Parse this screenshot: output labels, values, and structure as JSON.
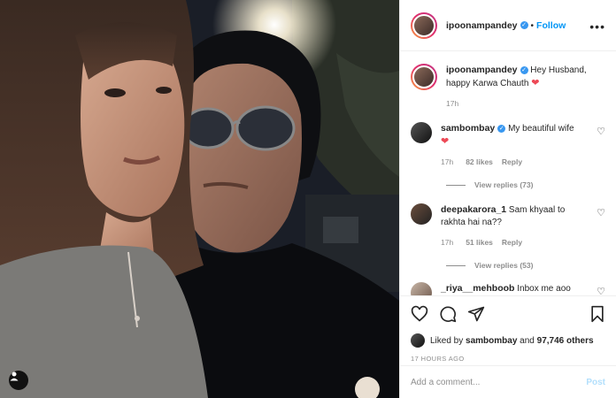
{
  "post": {
    "author": "ipoonampandey",
    "follow_label": "Follow",
    "more_label": "•••",
    "caption": {
      "user": "ipoonampandey",
      "text": "Hey Husband, happy Karwa Chauth",
      "time": "17h"
    }
  },
  "comments": [
    {
      "user": "sambombay",
      "verified": true,
      "text": "My beautiful wife",
      "time": "17h",
      "likes": "82 likes",
      "reply": "Reply",
      "view_replies": "View replies (73)"
    },
    {
      "user": "deepakarora_1",
      "verified": false,
      "text": "Sam khyaal to rakhta hai na??",
      "time": "17h",
      "likes": "51 likes",
      "reply": "Reply",
      "view_replies": "View replies (53)"
    },
    {
      "user": "_riya__mehboob",
      "verified": false,
      "text": "Inbox me aoo"
    }
  ],
  "liked_by": {
    "prefix": "Liked by",
    "user": "sambombay",
    "joiner": "and",
    "count": "97,746 others"
  },
  "timestamp": "17 HOURS AGO",
  "add_comment": {
    "placeholder": "Add a comment...",
    "post_label": "Post"
  },
  "colors": {
    "accent": "#0095f6",
    "heart": "#ed4956",
    "verified": "#3897f0"
  },
  "icons": [
    "heart-icon",
    "comment-icon",
    "share-icon",
    "bookmark-icon",
    "user-tag-icon",
    "more-icon"
  ]
}
